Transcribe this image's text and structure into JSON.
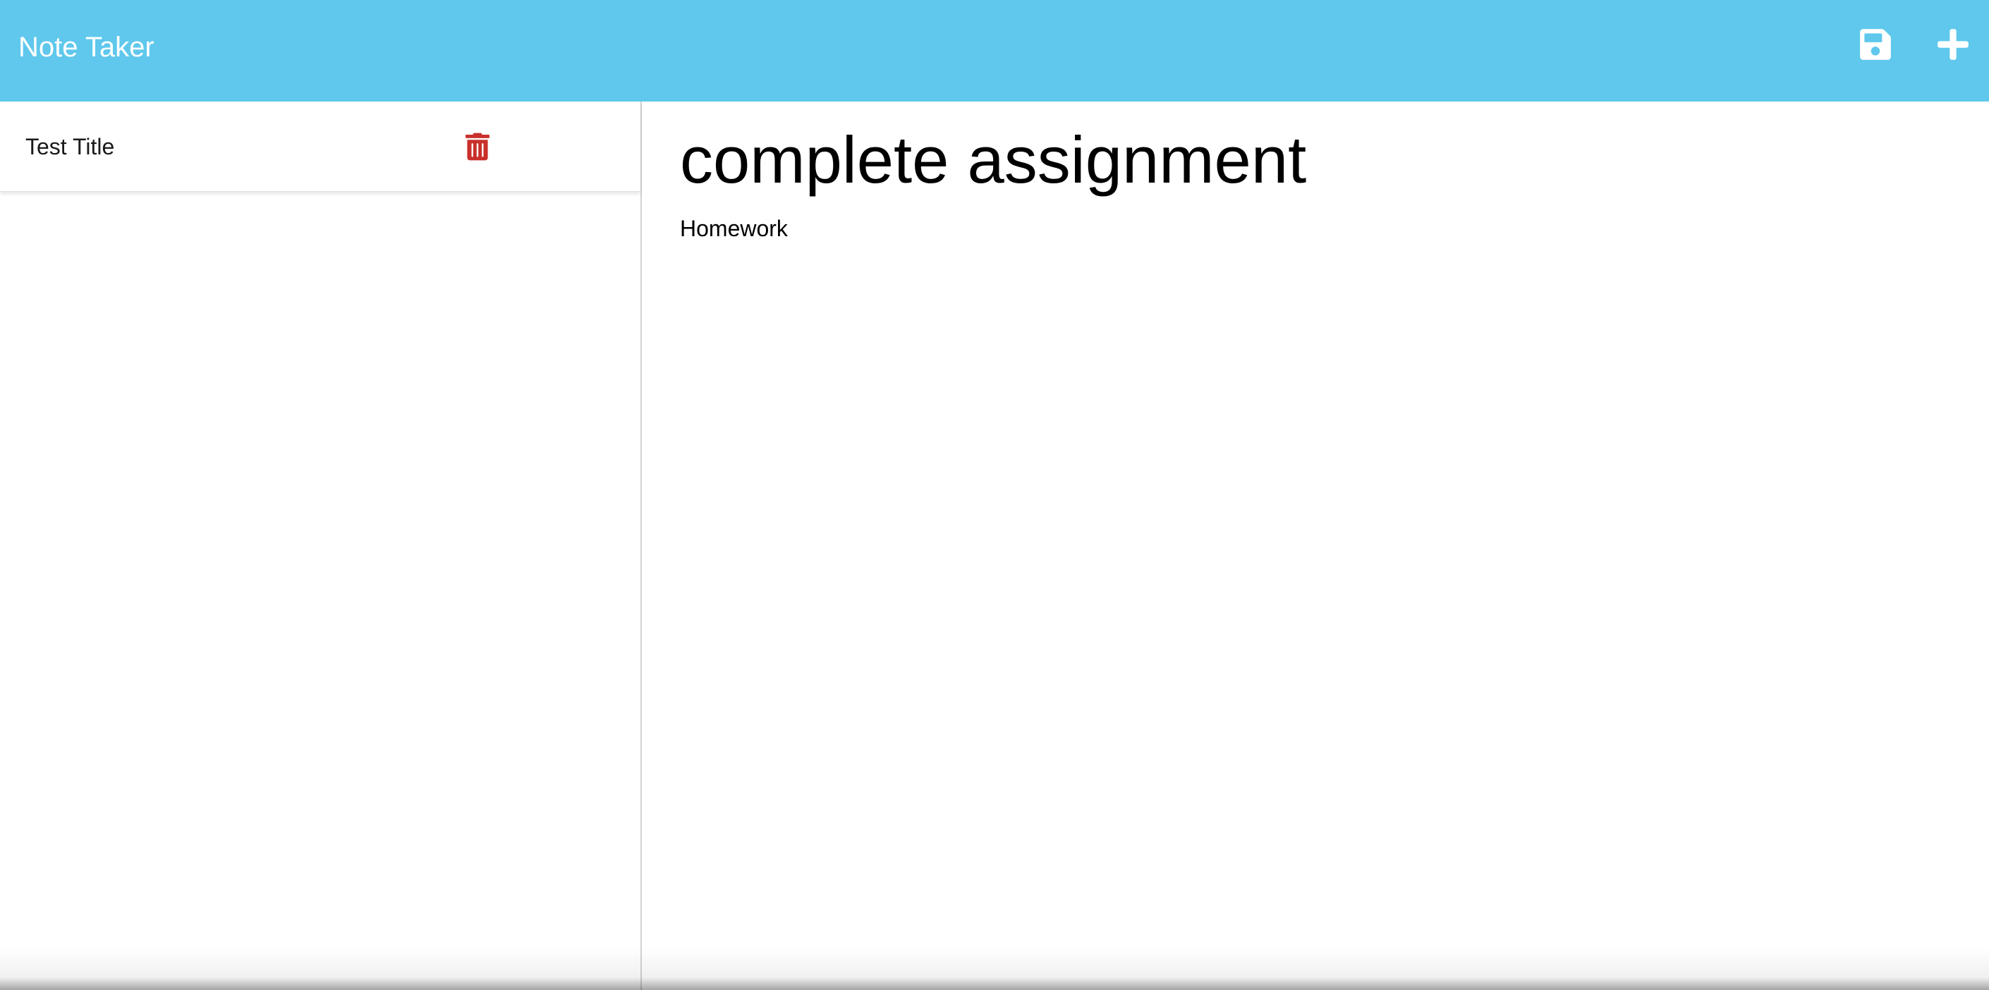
{
  "navbar": {
    "brand": "Note Taker",
    "save_icon": "save-icon",
    "new_icon": "plus-icon",
    "background_color": "#5fc8ec",
    "icon_color": "#ffffff"
  },
  "sidebar": {
    "notes": [
      {
        "title": "Test Title",
        "delete_icon": "trash-icon"
      }
    ],
    "delete_color": "#c9302c"
  },
  "editor": {
    "title": "complete assignment",
    "body": "Homework"
  }
}
